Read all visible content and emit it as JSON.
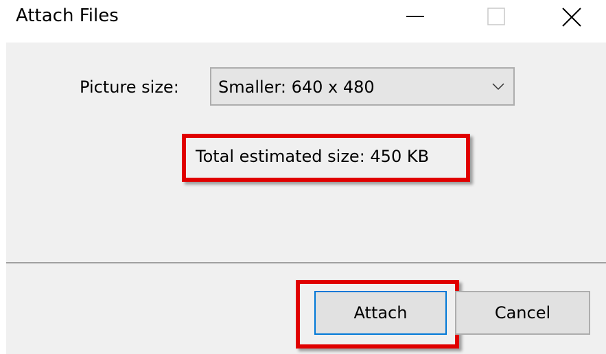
{
  "window": {
    "title": "Attach Files",
    "controls": {
      "minimize": "minimize-icon",
      "maximize": "maximize-icon",
      "close": "close-icon"
    }
  },
  "form": {
    "picture_size_label": "Picture size:",
    "picture_size_value": "Smaller: 640 x 480",
    "total_estimated_size": "Total estimated size: 450 KB"
  },
  "buttons": {
    "attach": "Attach",
    "cancel": "Cancel"
  },
  "colors": {
    "highlight": "#e00000",
    "focus_border": "#0078d7",
    "dialog_bg": "#f0f0f0"
  }
}
